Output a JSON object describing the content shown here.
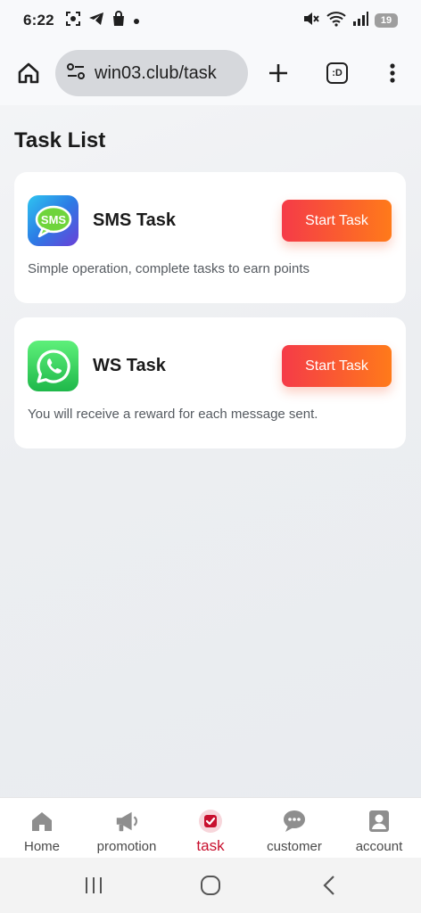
{
  "status_bar": {
    "time": "6:22",
    "battery": "19",
    "left_icons": [
      "screenshot-icon",
      "telegram-icon",
      "shopping-bag-icon",
      "dot-icon"
    ],
    "right_icons": [
      "mute-icon",
      "wifi-icon",
      "signal-icon",
      "battery-icon"
    ]
  },
  "browser": {
    "url": "win03.club/task",
    "tabs_label": ":D"
  },
  "page": {
    "title": "Task List"
  },
  "tasks": [
    {
      "name": "SMS Task",
      "icon_text": "SMS",
      "button_label": "Start Task",
      "description": "Simple operation, complete tasks to earn points"
    },
    {
      "name": "WS Task",
      "button_label": "Start Task",
      "description": "You will receive a reward for each message sent."
    }
  ],
  "bottom_nav": {
    "items": [
      {
        "label": "Home",
        "icon": "home-icon",
        "active": false
      },
      {
        "label": "promotion",
        "icon": "megaphone-icon",
        "active": false
      },
      {
        "label": "task",
        "icon": "task-check-icon",
        "active": true
      },
      {
        "label": "customer",
        "icon": "chat-icon",
        "active": false
      },
      {
        "label": "account",
        "icon": "account-icon",
        "active": false
      }
    ]
  },
  "colors": {
    "accent": "#c8102e",
    "button_gradient_start": "#f53b48",
    "button_gradient_end": "#ff7a1a"
  }
}
